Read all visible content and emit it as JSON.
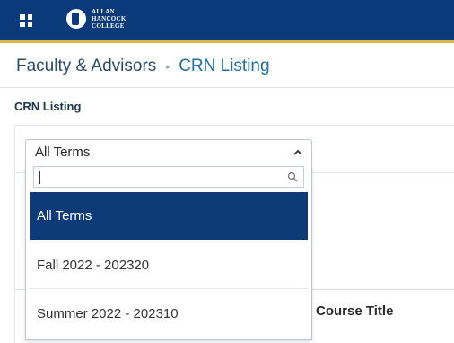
{
  "header": {
    "logo_line1": "ALLAN",
    "logo_line2": "HANCOCK",
    "logo_line3": "COLLEGE",
    "bar_color": "#0b3a7a",
    "accent_color": "#d9b64a",
    "menu_icon": "grid-icon"
  },
  "breadcrumb": {
    "parent": "Faculty & Advisors",
    "separator": "•",
    "current": "CRN Listing"
  },
  "section": {
    "title": "CRN Listing"
  },
  "term_select": {
    "selected": "All Terms",
    "search_value": "",
    "options": [
      {
        "label": "All Terms",
        "selected": true
      },
      {
        "label": "Fall 2022 - 202320",
        "selected": false
      },
      {
        "label": "Summer 2022 - 202310",
        "selected": false
      }
    ],
    "highlight_color": "#0c3b78"
  },
  "table": {
    "course_title_header": "Course Title"
  }
}
